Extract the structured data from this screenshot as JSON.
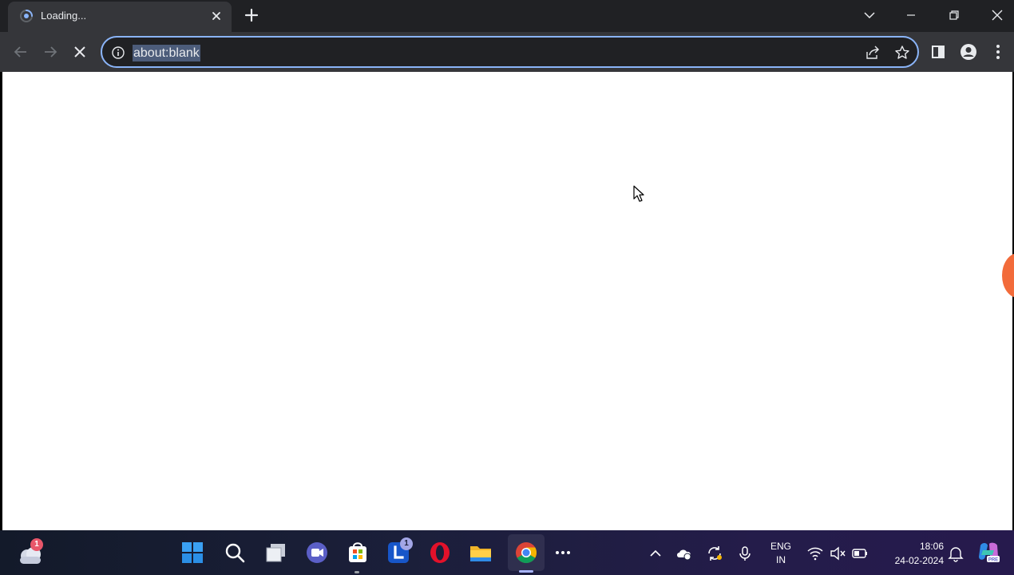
{
  "browser": {
    "tab": {
      "title": "Loading...",
      "favicon": "loading-spinner-icon"
    },
    "new_tab_icon": "plus-icon",
    "window_controls": [
      "tab-search-icon",
      "minimize-icon",
      "restore-icon",
      "close-icon"
    ],
    "toolbar": {
      "back_icon": "arrow-left-icon",
      "forward_icon": "arrow-right-icon",
      "stop_icon": "stop-x-icon",
      "omnibox": {
        "url": "about:blank",
        "info_icon": "info-icon",
        "share_icon": "share-icon",
        "star_icon": "star-icon"
      },
      "side_panel_icon": "side-panel-icon",
      "profile_icon": "profile-icon",
      "menu_icon": "kebab-menu-icon"
    },
    "accent": "#8ab4f8"
  },
  "page": {
    "background": "#ffffff"
  },
  "taskbar": {
    "weather_badge": "1",
    "apps": [
      {
        "name": "Start",
        "icon": "windows-start-icon"
      },
      {
        "name": "Search",
        "icon": "search-icon"
      },
      {
        "name": "Task View",
        "icon": "task-view-icon"
      },
      {
        "name": "Meet",
        "icon": "video-call-icon"
      },
      {
        "name": "Microsoft Store",
        "icon": "store-icon"
      },
      {
        "name": "L",
        "icon": "l-app-icon",
        "badge": "1"
      },
      {
        "name": "Opera",
        "icon": "opera-icon"
      },
      {
        "name": "File Explorer",
        "icon": "folder-icon"
      },
      {
        "name": "Chrome",
        "icon": "chrome-icon"
      },
      {
        "name": "More",
        "icon": "ellipsis-icon"
      }
    ],
    "tray": {
      "language_line1": "ENG",
      "language_line2": "IN",
      "time": "18:06",
      "date": "24-02-2024"
    }
  }
}
